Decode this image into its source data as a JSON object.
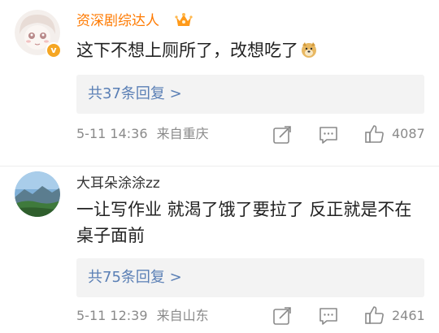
{
  "comments": [
    {
      "username": "资深剧综达人",
      "text": "这下不想上厕所了，改想吃了",
      "emoji": "doge-emoji",
      "replies_label": "共37条回复 >",
      "time": "5-11 14:36",
      "location": "来自重庆",
      "likes": "4087",
      "vip": true,
      "badge": "v"
    },
    {
      "username": "大耳朵涂涂zz",
      "text": "一让写作业 就渴了饿了要拉了 反正就是不在桌子面前",
      "replies_label": "共75条回复 >",
      "time": "5-11 12:39",
      "location": "来自山东",
      "likes": "2461",
      "vip": false
    }
  ],
  "icons": {
    "share": "share-icon",
    "comment": "comment-icon",
    "like": "thumbs-up-icon",
    "crown": "crown-icon"
  },
  "colors": {
    "vip_name": "#ff7a00",
    "reply_link": "#5a7fb5",
    "meta": "#8a8a8a"
  }
}
